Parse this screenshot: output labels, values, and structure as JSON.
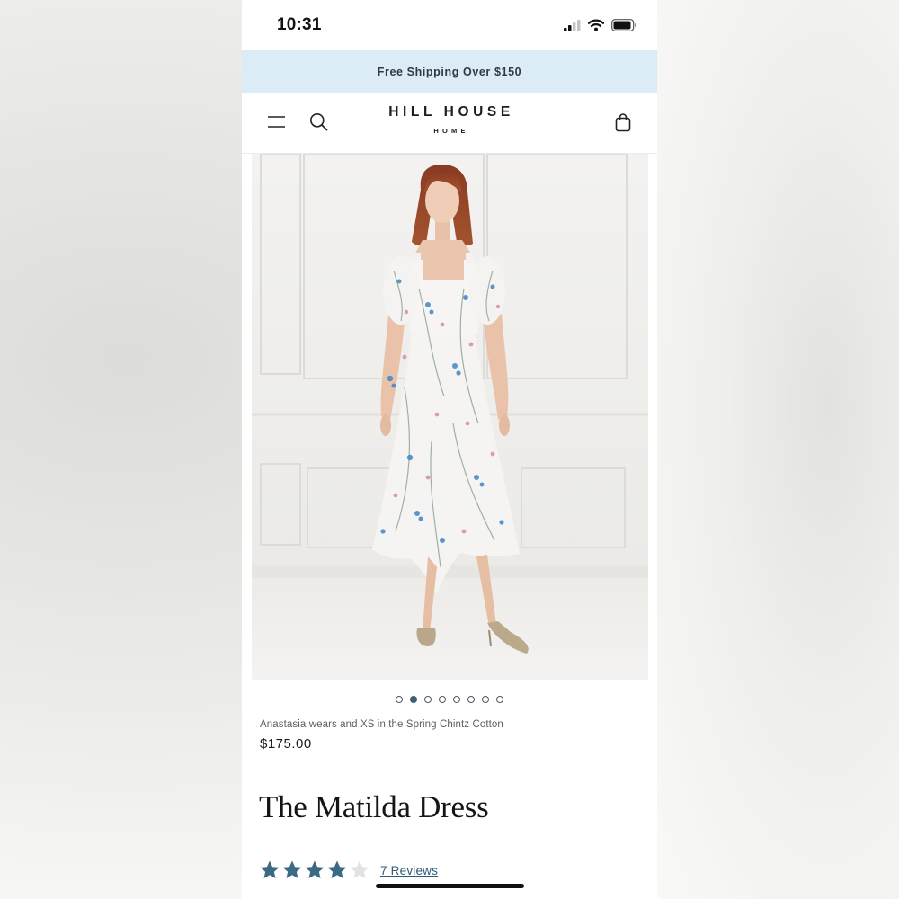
{
  "status_bar": {
    "time": "10:31"
  },
  "promo_banner": {
    "text": "Free Shipping Over $150",
    "background": "#dcecf7"
  },
  "header": {
    "brand_name": "HILL HOUSE",
    "brand_sub": "HOME",
    "icons": [
      "menu-icon",
      "search-icon",
      "shopping-bag-icon"
    ]
  },
  "product": {
    "image_description_icon": "product-photo",
    "carousel": {
      "total": 8,
      "active_index": 1
    },
    "caption": "Anastasia wears and XS in the Spring Chintz Cotton",
    "price": "$175.00",
    "title": "The Matilda Dress",
    "rating": {
      "value": 4,
      "max": 5,
      "star_color": "#3a6a85",
      "reviews_link": "7 Reviews"
    }
  }
}
